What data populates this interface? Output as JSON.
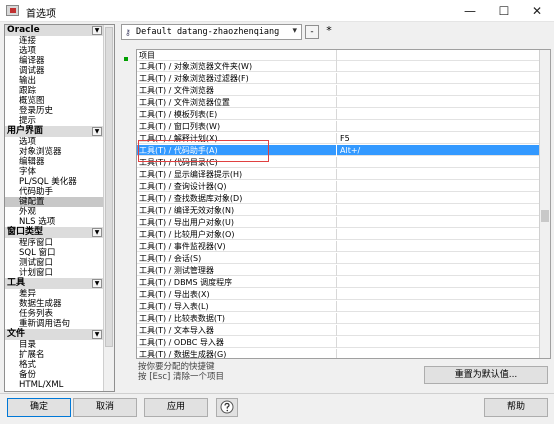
{
  "window": {
    "title": "首选项"
  },
  "titlebar": {
    "min": "—",
    "max": "☐",
    "close": "✕"
  },
  "nav": {
    "categories": [
      {
        "label": "Oracle",
        "items": [
          "连接",
          "选项",
          "编译器",
          "调试器",
          "输出",
          "跟踪",
          "概览图",
          "登录历史",
          "提示"
        ]
      },
      {
        "label": "用户界面",
        "items": [
          "选项",
          "对象浏览器",
          "编辑器",
          "字体",
          "PL/SQL 美化器",
          "代码助手",
          "键配置",
          "外观",
          "NLS 选项"
        ]
      },
      {
        "label": "窗口类型",
        "items": [
          "程序窗口",
          "SQL 窗口",
          "测试窗口",
          "计划窗口"
        ]
      },
      {
        "label": "工具",
        "items": [
          "差异",
          "数据生成器",
          "任务列表",
          "重新调用语句"
        ]
      },
      {
        "label": "文件",
        "items": [
          "目录",
          "扩展名",
          "格式",
          "备份",
          "HTML/XML"
        ]
      }
    ],
    "active": "键配置"
  },
  "profile": {
    "value": "Default datang-zhaozhenqiang",
    "remove": "-",
    "add": "*"
  },
  "grid": {
    "header": [
      "项目",
      ""
    ],
    "rows": [
      [
        "工具(T) / 对象浏览器文件夹(W)",
        ""
      ],
      [
        "工具(T) / 对象浏览器过滤器(F)",
        ""
      ],
      [
        "工具(T) / 文件浏览器",
        ""
      ],
      [
        "工具(T) / 文件浏览器位置",
        ""
      ],
      [
        "工具(T) / 模板列表(E)",
        ""
      ],
      [
        "工具(T) / 窗口列表(W)",
        ""
      ],
      [
        "工具(T) / 解释计划(X)",
        "F5"
      ],
      [
        "工具(T) / 代码助手(A)",
        "Alt+/"
      ],
      [
        "工具(T) / 代码目录(C)",
        ""
      ],
      [
        "工具(T) / 显示编译器提示(H)",
        ""
      ],
      [
        "工具(T) / 查询设计器(Q)",
        ""
      ],
      [
        "工具(T) / 查找数据库对象(D)",
        ""
      ],
      [
        "工具(T) / 编译无效对象(N)",
        ""
      ],
      [
        "工具(T) / 导出用户对象(U)",
        ""
      ],
      [
        "工具(T) / 比较用户对象(O)",
        ""
      ],
      [
        "工具(T) / 事件监视器(V)",
        ""
      ],
      [
        "工具(T) / 会话(S)",
        ""
      ],
      [
        "工具(T) / 测试管理器",
        ""
      ],
      [
        "工具(T) / DBMS 调度程序",
        ""
      ],
      [
        "工具(T) / 导出表(X)",
        ""
      ],
      [
        "工具(T) / 导入表(L)",
        ""
      ],
      [
        "工具(T) / 比较表数据(T)",
        ""
      ],
      [
        "工具(T) / 文本导入器",
        ""
      ],
      [
        "工具(T) / ODBC 导入器",
        ""
      ],
      [
        "工具(T) / 数据生成器(G)",
        ""
      ]
    ],
    "selected_index": 7
  },
  "hint": {
    "line1": "按你要分配的快捷键",
    "line2": "按 [Esc] 清除一个项目"
  },
  "buttons": {
    "reset": "重置为默认值...",
    "ok": "确定",
    "cancel": "取消",
    "apply": "应用",
    "help": "帮助"
  }
}
